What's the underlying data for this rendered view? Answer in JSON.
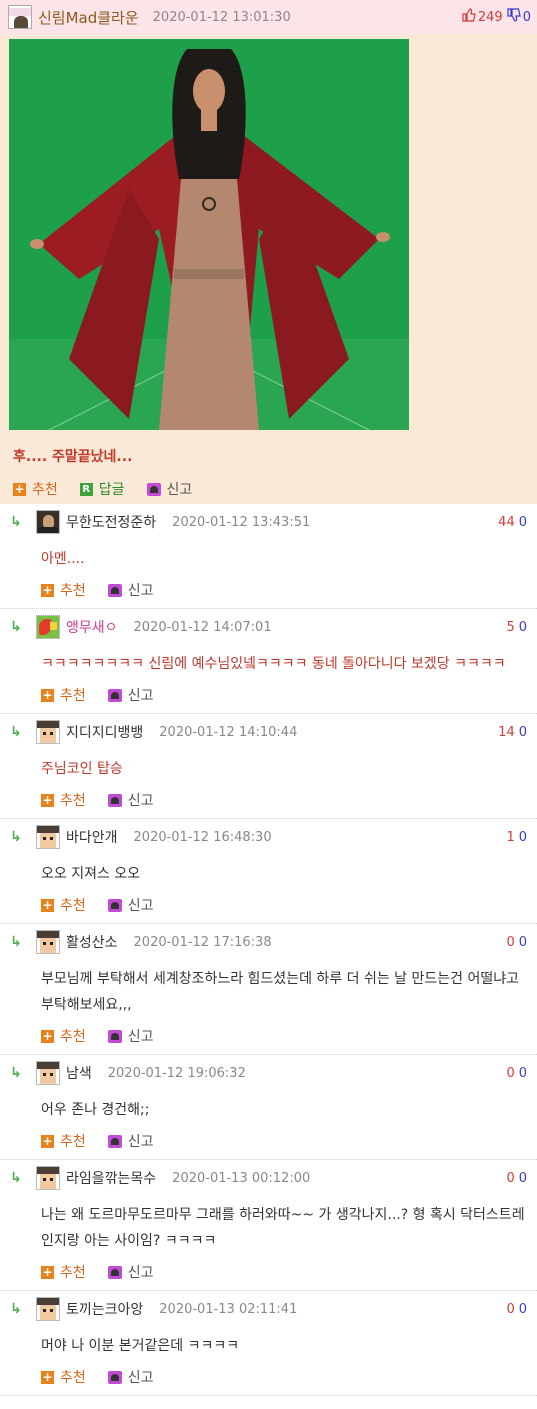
{
  "post": {
    "author": "신림Mad클라운",
    "avatar_label": "신림매드",
    "time": "2020-01-12 13:01:30",
    "up": "249",
    "down": "0",
    "text": "후.... 주말끝났네...",
    "actions": {
      "recommend": "추천",
      "reply": "답글",
      "report": "신고"
    }
  },
  "comments": [
    {
      "author": "무한도전정준하",
      "time": "2020-01-12 13:43:51",
      "up": "44",
      "down": "0",
      "text": "아멘....",
      "avatar": "photo"
    },
    {
      "author": "앵무새ㅇ",
      "time": "2020-01-12 14:07:01",
      "up": "5",
      "down": "0",
      "text": "ㅋㅋㅋㅋㅋㅋㅋㅋ 신림에 예수님있넼ㅋㅋㅋㅋ 동네 돌아다니다 보겠당 ㅋㅋㅋㅋ",
      "avatar": "parrot"
    },
    {
      "author": "지디지디뱅뱅",
      "time": "2020-01-12 14:10:44",
      "up": "14",
      "down": "0",
      "text": "주님코인 탑승",
      "avatar": "pixel"
    },
    {
      "author": "바다안개",
      "time": "2020-01-12 16:48:30",
      "up": "1",
      "down": "0",
      "text": "오오 지져스 오오",
      "avatar": "pixel"
    },
    {
      "author": "활성산소",
      "time": "2020-01-12 17:16:38",
      "up": "0",
      "down": "0",
      "text": "부모님께 부탁해서 세계창조하느라 힘드셨는데 하루 더 쉬는 날 만드는건 어떨냐고 부탁해보세요,,,",
      "avatar": "pixel"
    },
    {
      "author": "남색",
      "time": "2020-01-12 19:06:32",
      "up": "0",
      "down": "0",
      "text": "어우 존나 경건해;;",
      "avatar": "pixel"
    },
    {
      "author": "라임을깎는목수",
      "time": "2020-01-13 00:12:00",
      "up": "0",
      "down": "0",
      "text": "나는 왜 도르마무도르마무 그래를 하러와따~~ 가 생각나지...? 형 혹시 닥터스트레인지랑 아는 사이임? ㅋㅋㅋㅋ",
      "avatar": "pixel"
    },
    {
      "author": "토끼는크아앙",
      "time": "2020-01-13 02:11:41",
      "up": "0",
      "down": "0",
      "text": "머야 나 이분 본거같은데 ㅋㅋㅋㅋ",
      "avatar": "pixel"
    }
  ],
  "comment_actions": {
    "recommend": "추천",
    "report": "신고"
  },
  "colors": {
    "post_bg": "#fbe9d8",
    "header_bg": "#fce4e8",
    "accent_red": "#c0392b",
    "up": "#d23b3b",
    "down": "#3b3bd2",
    "robe": "#9b1c22",
    "backdrop": "#1ea04a"
  }
}
